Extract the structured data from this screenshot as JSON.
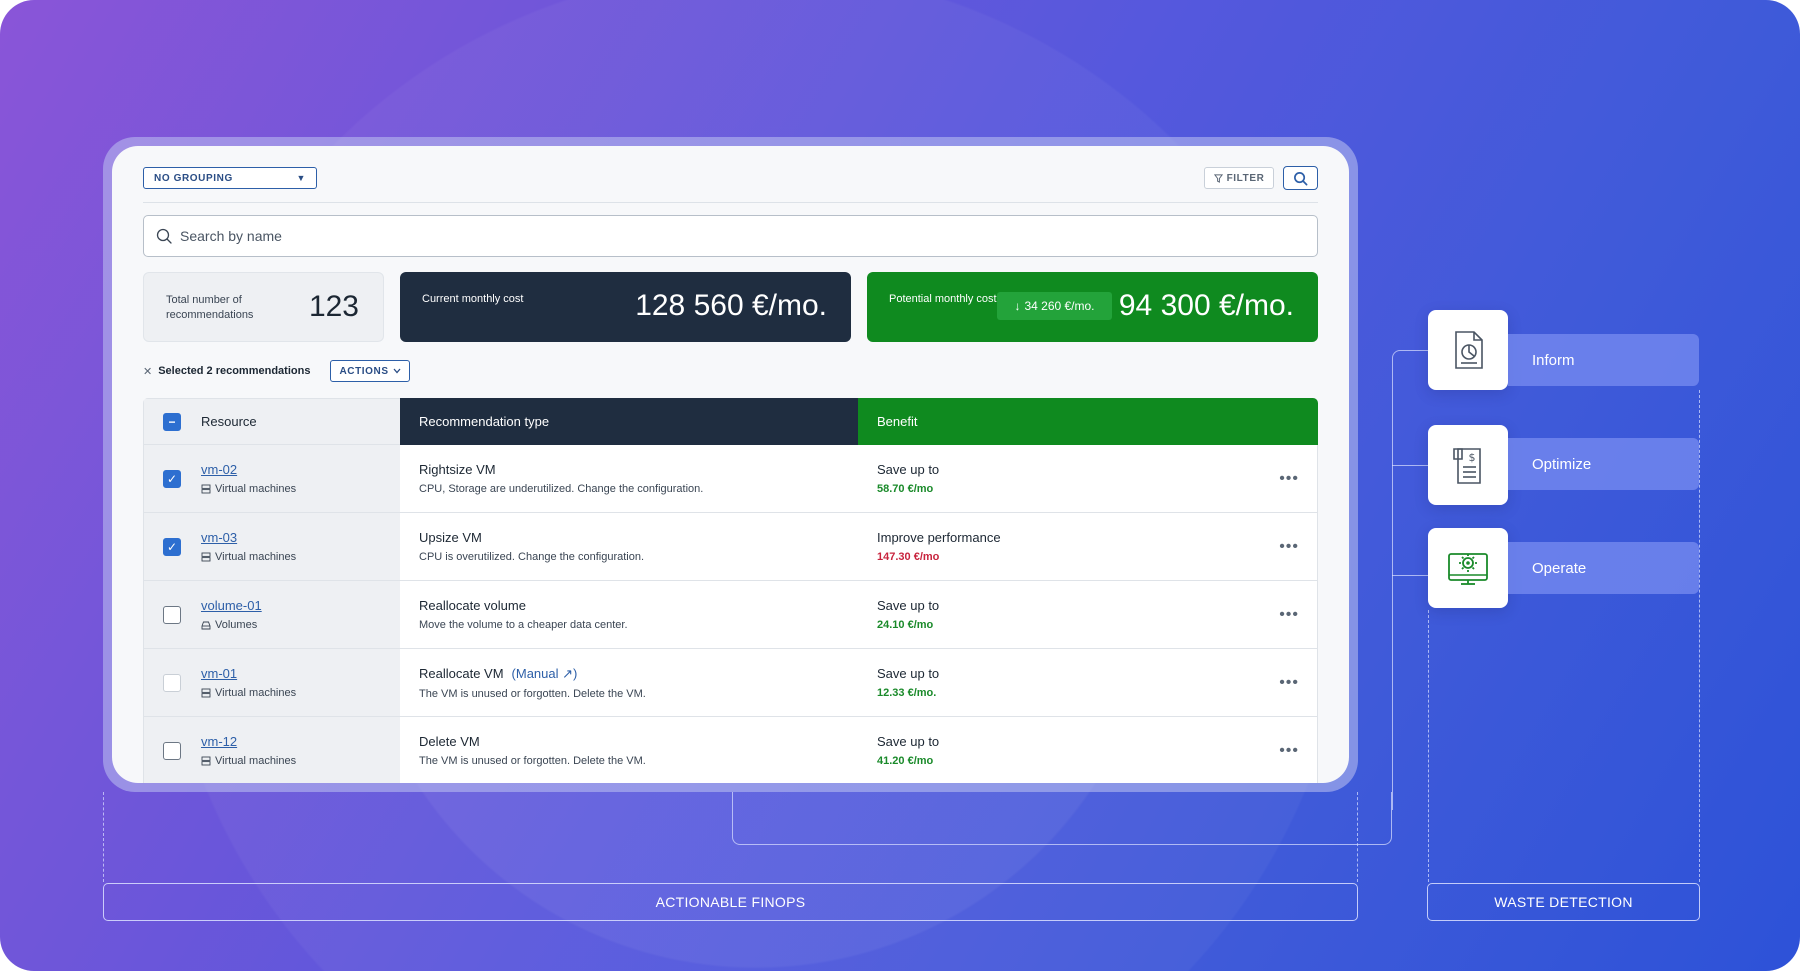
{
  "toolbar": {
    "grouping_label": "NO GROUPING",
    "filter_label": "FILTER"
  },
  "search": {
    "placeholder": "Search by name"
  },
  "stats": {
    "total_label": "Total number of recommendations",
    "total_value": "123",
    "current_label": "Current monthly cost",
    "current_value": "128 560 €/mo.",
    "potential_label": "Potential monthly cost",
    "potential_savings": "34 260 €/mo.",
    "potential_value": "94 300 €/mo."
  },
  "selection": {
    "text": "Selected 2 recommendations",
    "actions_label": "ACTIONS"
  },
  "table": {
    "headers": {
      "resource": "Resource",
      "type": "Recommendation type",
      "benefit": "Benefit"
    },
    "rows": [
      {
        "name": "vm-02",
        "kind": "Virtual machines",
        "kind_icon": "server-icon",
        "checkbox": "checked",
        "type": "Rightsize VM",
        "manual": "",
        "desc": "CPU, Storage are underutilized. Change the configuration.",
        "benefit": "Save up to",
        "amount": "58.70 €/mo",
        "amount_color": "green"
      },
      {
        "name": "vm-03",
        "kind": "Virtual machines",
        "kind_icon": "server-icon",
        "checkbox": "checked",
        "type": "Upsize VM",
        "manual": "",
        "desc": "CPU is overutilized. Change the configuration.",
        "benefit": "Improve performance",
        "amount": "147.30 €/mo",
        "amount_color": "red"
      },
      {
        "name": "volume-01",
        "kind": "Volumes",
        "kind_icon": "disk-icon",
        "checkbox": "unchecked",
        "type": "Reallocate volume",
        "manual": "",
        "desc": "Move the volume to a cheaper data center.",
        "benefit": "Save up to",
        "amount": "24.10 €/mo",
        "amount_color": "green"
      },
      {
        "name": "vm-01",
        "kind": "Virtual machines",
        "kind_icon": "server-icon",
        "checkbox": "disabled",
        "type": "Reallocate VM",
        "manual": "(Manual ↗)",
        "desc": "The VM is unused or forgotten. Delete the VM.",
        "benefit": "Save up to",
        "amount": "12.33 €/mo.",
        "amount_color": "green"
      },
      {
        "name": "vm-12",
        "kind": "Virtual machines",
        "kind_icon": "server-icon",
        "checkbox": "unchecked",
        "type": "Delete VM",
        "manual": "",
        "desc": "The VM is unused or forgotten. Delete the VM.",
        "benefit": "Save up to",
        "amount": "41.20 €/mo",
        "amount_color": "green"
      }
    ]
  },
  "steps": [
    {
      "label": "Inform",
      "icon": "report-chart-icon"
    },
    {
      "label": "Optimize",
      "icon": "invoice-dollar-icon"
    },
    {
      "label": "Operate",
      "icon": "monitor-gear-icon"
    }
  ],
  "footer": {
    "left_label": "ACTIONABLE FINOPS",
    "right_label": "WASTE DETECTION"
  },
  "colors": {
    "dark": "#1f2d40",
    "green": "#0f8a1f",
    "link": "#2d5fa8",
    "save_green": "#1a8a2a",
    "perf_red": "#c8243e"
  }
}
